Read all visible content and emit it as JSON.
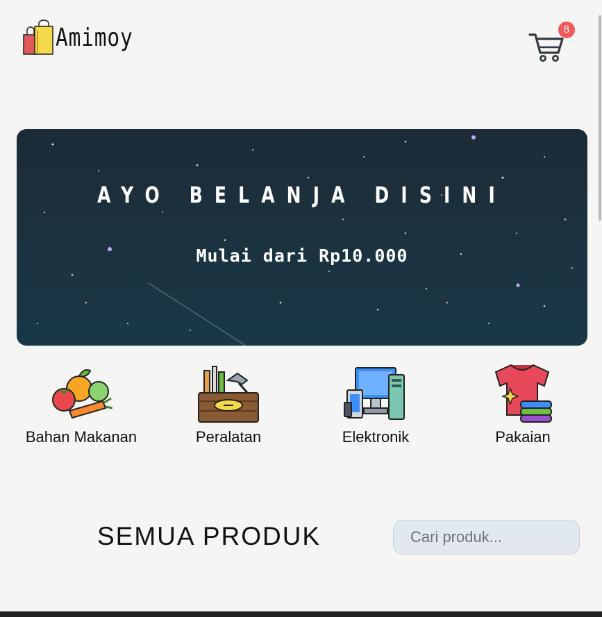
{
  "brand": {
    "name": "Amimoy",
    "logo_icon": "shopping-bags-icon"
  },
  "cart": {
    "icon": "cart-icon",
    "count": "8",
    "badge_color": "#ef5b5b"
  },
  "hero": {
    "title": "AYO BELANJA DISINI",
    "subtitle": "Mulai dari Rp10.000",
    "background_color": "#1c2f3b"
  },
  "categories": [
    {
      "label": "Bahan Makanan",
      "icon": "vegetables-icon"
    },
    {
      "label": "Peralatan",
      "icon": "toolbox-icon"
    },
    {
      "label": "Elektronik",
      "icon": "computer-devices-icon"
    },
    {
      "label": "Pakaian",
      "icon": "clothes-icon"
    }
  ],
  "products": {
    "section_title": "SEMUA PRODUK",
    "search_placeholder": "Cari produk..."
  }
}
